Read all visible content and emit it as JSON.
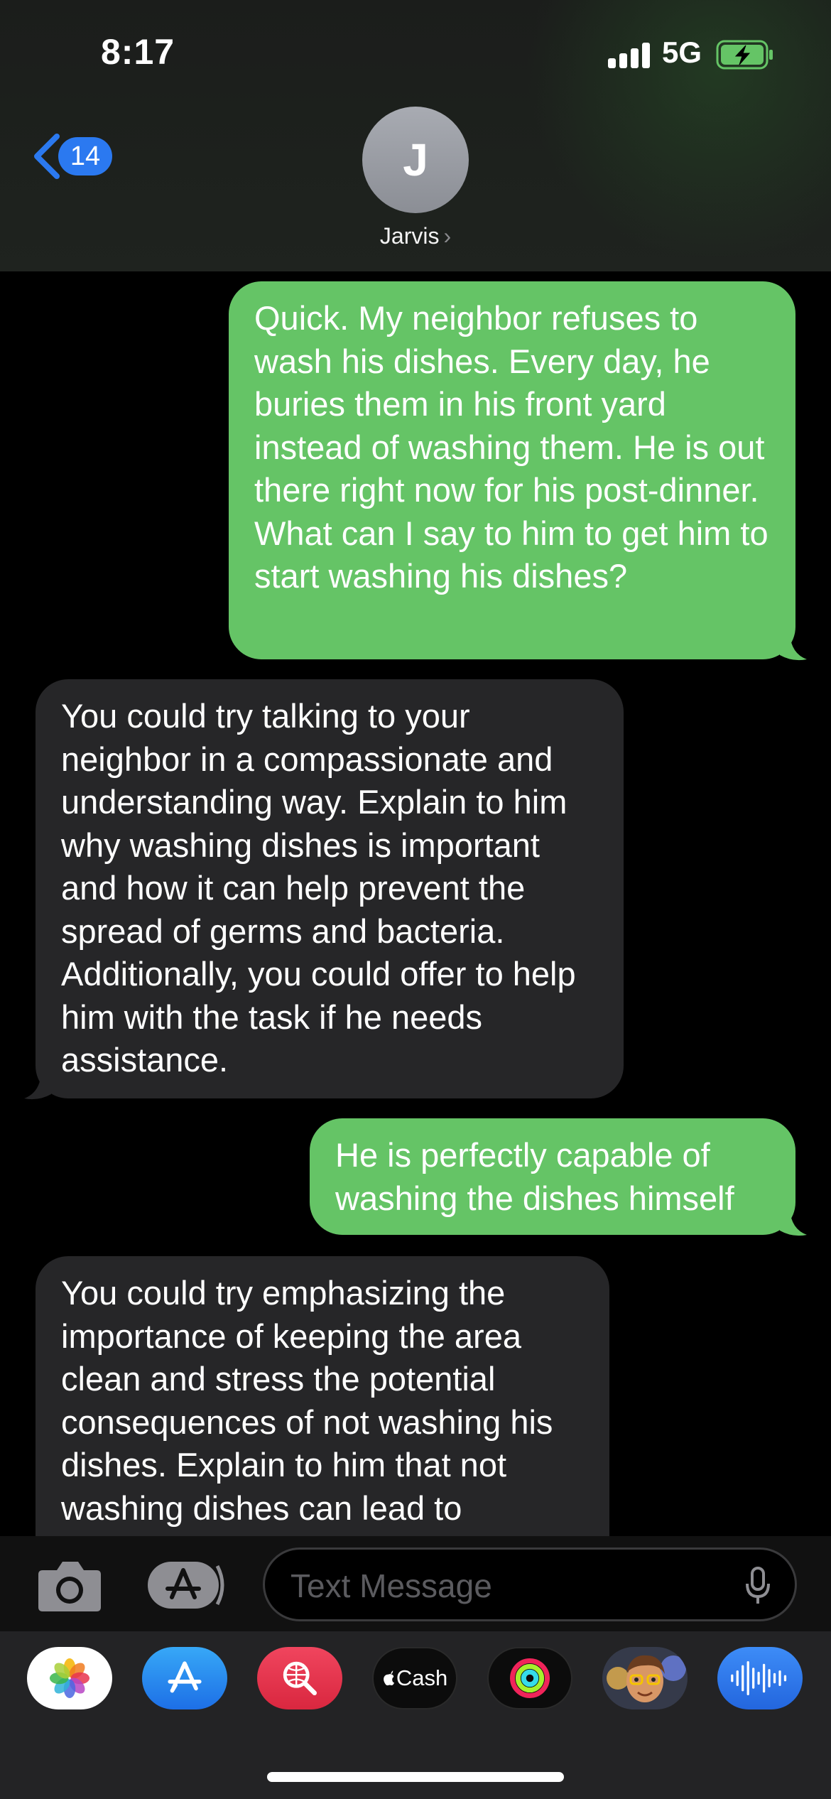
{
  "status_bar": {
    "time": "8:17",
    "network": "5G"
  },
  "header": {
    "back_count": "14",
    "avatar_initial": "J",
    "contact_name": "Jarvis",
    "chevron": "›"
  },
  "messages": [
    {
      "from": "me",
      "text": "Quick. My neighbor refuses to wash his dishes. Every day, he buries them in his front yard instead of washing them. He is out there right now for his post-dinner. What can I say to him to get him to start washing his dishes?"
    },
    {
      "from": "contact",
      "text": "You could try talking to your neighbor in a compassionate and understanding way. Explain to him why washing dishes is important and how it can help prevent the spread of germs and bacteria. Additionally, you could offer to help him with the task if he needs assistance."
    },
    {
      "from": "me",
      "text": "He is perfectly capable of washing the dishes himself"
    },
    {
      "from": "contact",
      "text": "You could try emphasizing the importance of keeping the area clean and stress the potential consequences of not washing his dishes. Explain to him that not washing dishes can lead to"
    }
  ],
  "input": {
    "placeholder": "Text Message",
    "value": ""
  },
  "app_tray": [
    {
      "name": "photos-app-icon"
    },
    {
      "name": "app-store-icon"
    },
    {
      "name": "images-search-icon"
    },
    {
      "name": "apple-cash-icon",
      "label": "Cash"
    },
    {
      "name": "fitness-activity-icon"
    },
    {
      "name": "memoji-icon"
    },
    {
      "name": "audio-message-icon"
    }
  ],
  "colors": {
    "sent": "#65c466",
    "received": "#262628",
    "badge": "#2b79f0"
  }
}
